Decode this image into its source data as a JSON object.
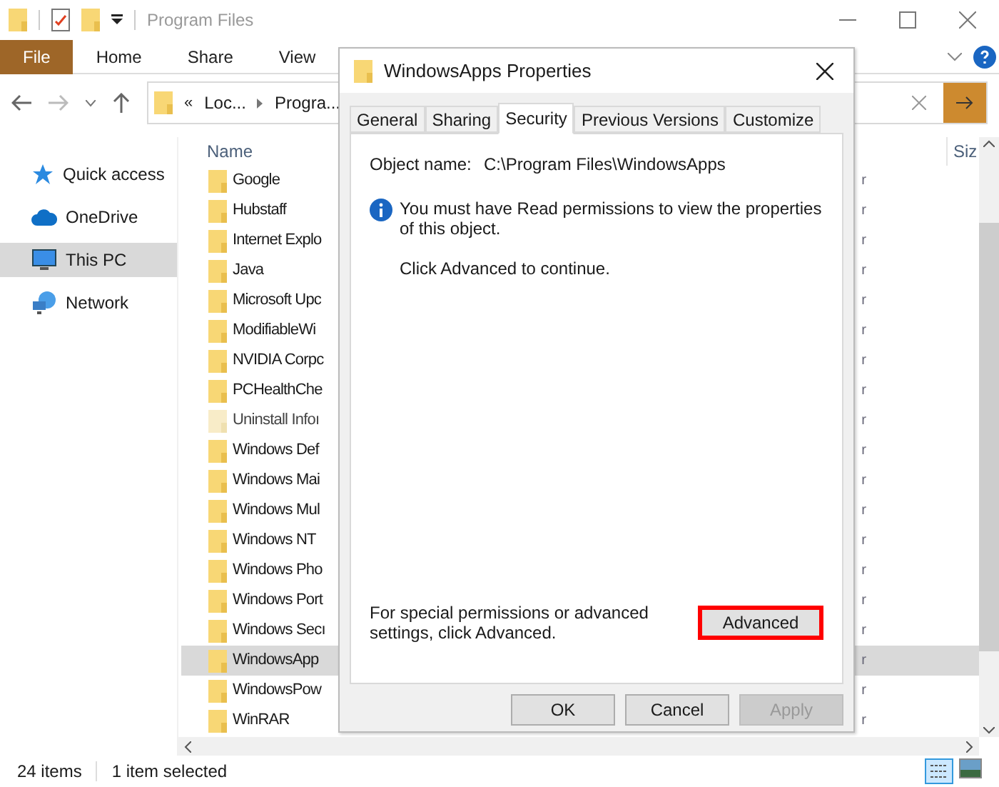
{
  "window": {
    "title": "Program Files"
  },
  "ribbon": {
    "tabs": [
      {
        "label": "File",
        "selected": true
      },
      {
        "label": "Home",
        "selected": false
      },
      {
        "label": "Share",
        "selected": false
      },
      {
        "label": "View",
        "selected": false
      }
    ]
  },
  "address_bar": {
    "prefix": "«",
    "crumbs": [
      "Loc...",
      "Progra..."
    ]
  },
  "nav": [
    {
      "label": "Quick access",
      "kind": "star",
      "selected": false
    },
    {
      "label": "OneDrive",
      "kind": "cloud",
      "selected": false
    },
    {
      "label": "This PC",
      "kind": "pc",
      "selected": true
    },
    {
      "label": "Network",
      "kind": "network",
      "selected": false
    }
  ],
  "file_list": {
    "columns": [
      "Name",
      "Siz"
    ],
    "rows": [
      {
        "name": "Google",
        "column_2": "r",
        "hidden": false,
        "selected": false
      },
      {
        "name": "Hubstaff",
        "column_2": "r",
        "hidden": false,
        "selected": false
      },
      {
        "name": "Internet Explo",
        "column_2": "r",
        "hidden": false,
        "selected": false
      },
      {
        "name": "Java",
        "column_2": "r",
        "hidden": false,
        "selected": false
      },
      {
        "name": "Microsoft Upc",
        "column_2": "r",
        "hidden": false,
        "selected": false
      },
      {
        "name": "ModifiableWi",
        "column_2": "r",
        "hidden": false,
        "selected": false
      },
      {
        "name": "NVIDIA Corpc",
        "column_2": "r",
        "hidden": false,
        "selected": false
      },
      {
        "name": "PCHealthChe",
        "column_2": "r",
        "hidden": false,
        "selected": false
      },
      {
        "name": "Uninstall Infoı",
        "column_2": "r",
        "hidden": true,
        "selected": false
      },
      {
        "name": "Windows Def",
        "column_2": "r",
        "hidden": false,
        "selected": false
      },
      {
        "name": "Windows Mai",
        "column_2": "r",
        "hidden": false,
        "selected": false
      },
      {
        "name": "Windows Mul",
        "column_2": "r",
        "hidden": false,
        "selected": false
      },
      {
        "name": "Windows NT",
        "column_2": "r",
        "hidden": false,
        "selected": false
      },
      {
        "name": "Windows Pho",
        "column_2": "r",
        "hidden": false,
        "selected": false
      },
      {
        "name": "Windows Port",
        "column_2": "r",
        "hidden": false,
        "selected": false
      },
      {
        "name": "Windows Secı",
        "column_2": "r",
        "hidden": false,
        "selected": false
      },
      {
        "name": "WindowsApp",
        "column_2": "r",
        "hidden": false,
        "selected": true
      },
      {
        "name": "WindowsPow",
        "column_2": "r",
        "hidden": false,
        "selected": false
      },
      {
        "name": "WinRAR",
        "column_2": "r",
        "hidden": false,
        "selected": false
      }
    ]
  },
  "status_bar": {
    "count": "24 items",
    "selection": "1 item selected"
  },
  "dialog": {
    "title": "WindowsApps Properties",
    "tabs": [
      {
        "label": "General",
        "selected": false
      },
      {
        "label": "Sharing",
        "selected": false
      },
      {
        "label": "Security",
        "selected": true
      },
      {
        "label": "Previous Versions",
        "selected": false
      },
      {
        "label": "Customize",
        "selected": false
      }
    ],
    "object_label": "Object name:",
    "object_value": "C:\\Program Files\\WindowsApps",
    "info": "You must have Read permissions to view the properties of this object.",
    "hint": "Click Advanced to continue.",
    "advanced_text": "For special permissions or advanced settings, click Advanced.",
    "advanced_button": {
      "label": "Advanced",
      "highlighted": true
    },
    "buttons": [
      {
        "label": "OK",
        "disabled": false
      },
      {
        "label": "Cancel",
        "disabled": false
      },
      {
        "label": "Apply",
        "disabled": true
      }
    ]
  }
}
